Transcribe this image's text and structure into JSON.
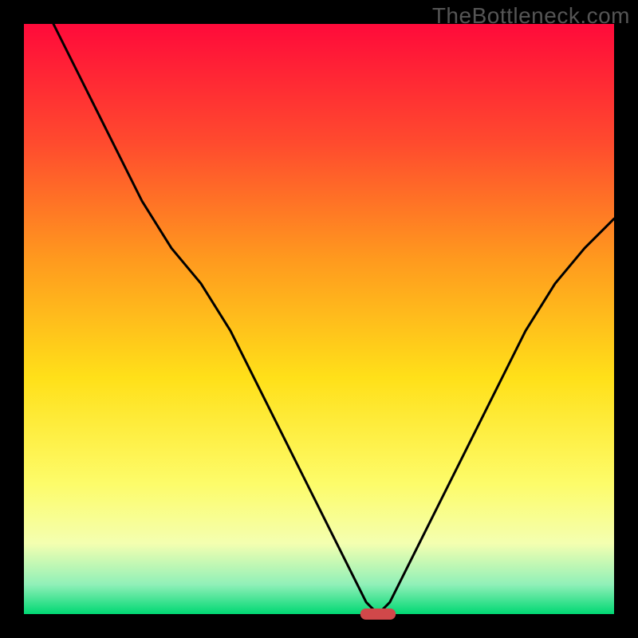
{
  "watermark": "TheBottleneck.com",
  "chart_data": {
    "type": "line",
    "title": "",
    "xlabel": "",
    "ylabel": "",
    "xlim": [
      0,
      100
    ],
    "ylim": [
      0,
      100
    ],
    "grid": false,
    "series": [
      {
        "name": "bottleneck-curve",
        "x": [
          5,
          10,
          15,
          20,
          25,
          30,
          35,
          40,
          45,
          50,
          55,
          58,
          60,
          62,
          65,
          70,
          75,
          80,
          85,
          90,
          95,
          100
        ],
        "values": [
          100,
          90,
          80,
          70,
          62,
          56,
          48,
          38,
          28,
          18,
          8,
          2,
          0,
          2,
          8,
          18,
          28,
          38,
          48,
          56,
          62,
          67
        ]
      }
    ],
    "marker": {
      "name": "optimal-point",
      "x_center": 60,
      "y": 0,
      "width": 6,
      "color": "#d1484a"
    },
    "background_gradient": {
      "stops": [
        {
          "offset": 0.0,
          "color": "#ff0a3a"
        },
        {
          "offset": 0.2,
          "color": "#ff4a2e"
        },
        {
          "offset": 0.4,
          "color": "#ff9a1e"
        },
        {
          "offset": 0.6,
          "color": "#ffe019"
        },
        {
          "offset": 0.78,
          "color": "#fdfc6a"
        },
        {
          "offset": 0.88,
          "color": "#f4ffb0"
        },
        {
          "offset": 0.95,
          "color": "#90f0b8"
        },
        {
          "offset": 1.0,
          "color": "#00d873"
        }
      ]
    },
    "frame": {
      "border_width_px": 30,
      "color": "#000000"
    }
  }
}
